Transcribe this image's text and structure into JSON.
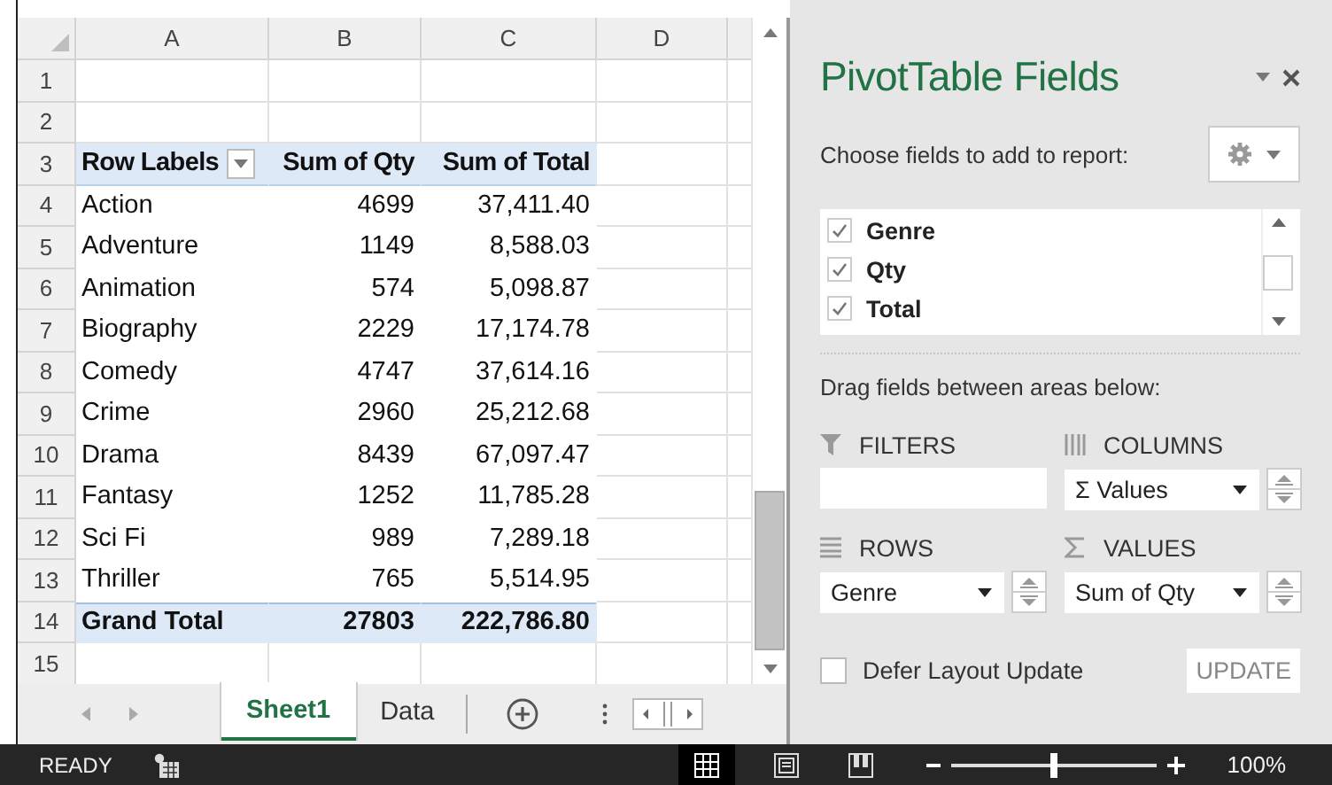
{
  "sheet": {
    "columns": [
      "A",
      "B",
      "C",
      "D"
    ],
    "rows": [
      {
        "number": "1",
        "kind": "blank"
      },
      {
        "number": "2",
        "kind": "blank"
      },
      {
        "number": "3",
        "kind": "header",
        "label": "Row Labels",
        "qty": "Sum of Qty",
        "total": "Sum of Total"
      },
      {
        "number": "4",
        "kind": "item",
        "label": "Action",
        "qty": "4699",
        "total": "37,411.40"
      },
      {
        "number": "5",
        "kind": "item",
        "label": "Adventure",
        "qty": "1149",
        "total": "8,588.03"
      },
      {
        "number": "6",
        "kind": "item",
        "label": "Animation",
        "qty": "574",
        "total": "5,098.87"
      },
      {
        "number": "7",
        "kind": "item",
        "label": "Biography",
        "qty": "2229",
        "total": "17,174.78"
      },
      {
        "number": "8",
        "kind": "item",
        "label": "Comedy",
        "qty": "4747",
        "total": "37,614.16"
      },
      {
        "number": "9",
        "kind": "item",
        "label": "Crime",
        "qty": "2960",
        "total": "25,212.68"
      },
      {
        "number": "10",
        "kind": "item",
        "label": "Drama",
        "qty": "8439",
        "total": "67,097.47"
      },
      {
        "number": "11",
        "kind": "item",
        "label": "Fantasy",
        "qty": "1252",
        "total": "11,785.28"
      },
      {
        "number": "12",
        "kind": "item",
        "label": "Sci Fi",
        "qty": "989",
        "total": "7,289.18"
      },
      {
        "number": "13",
        "kind": "item",
        "label": "Thriller",
        "qty": "765",
        "total": "5,514.95"
      },
      {
        "number": "14",
        "kind": "total",
        "label": "Grand Total",
        "qty": "27803",
        "total": "222,786.80"
      },
      {
        "number": "15",
        "kind": "blank"
      }
    ]
  },
  "sheet_tabs": [
    {
      "label": "Sheet1",
      "selected": true
    },
    {
      "label": "Data",
      "selected": false
    }
  ],
  "status_bar": {
    "mode": "READY",
    "zoom": "100%",
    "zoom_slider": {
      "level": 0.5
    }
  },
  "panel": {
    "title": "PivotTable Fields",
    "subtitle": "Choose fields to add to report:",
    "fields": [
      {
        "label": "Genre",
        "checked": true
      },
      {
        "label": "Qty",
        "checked": true
      },
      {
        "label": "Total",
        "checked": true
      }
    ],
    "drag_hint": "Drag fields between areas below:",
    "areas": [
      {
        "kind": "filters",
        "label": "FILTERS"
      },
      {
        "kind": "columns",
        "label": "COLUMNS",
        "items": [
          "Σ Values"
        ]
      },
      {
        "kind": "rows",
        "label": "ROWS",
        "items": [
          "Genre"
        ]
      },
      {
        "kind": "values",
        "label": "VALUES",
        "items": [
          "Sum of Qty"
        ]
      }
    ],
    "defer": {
      "label": "Defer Layout Update",
      "checked": false
    },
    "update_button": "UPDATE"
  }
}
